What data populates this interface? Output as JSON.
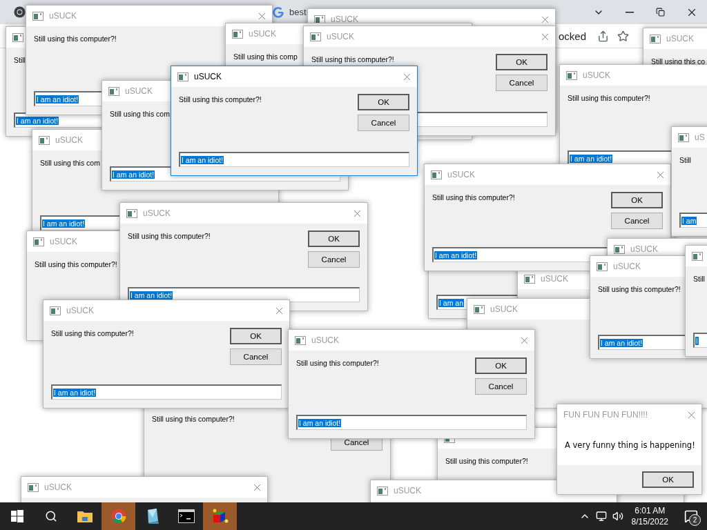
{
  "browser": {
    "tab_title": "best",
    "address_text": "ocked"
  },
  "windows": [
    {
      "kind": "dialog",
      "message": "Still",
      "field": {
        "value": "I am an idiot!",
        "selected": true
      }
    },
    {
      "kind": "dialog",
      "title": "uSUCK",
      "active": false,
      "close": true,
      "message": "Still using this computer?!",
      "field": {
        "value": "I am an idiot!",
        "selected": true
      }
    },
    {
      "kind": "dialog",
      "title": "uSUCK",
      "active": false,
      "close": true
    },
    {
      "kind": "dialog",
      "title": "uSUCK",
      "active": false,
      "message": "Still using this comp"
    },
    {
      "kind": "dialog",
      "title": "uSUCK",
      "active": false,
      "close": true,
      "message": "Still using this computer?!",
      "buttons": [
        {
          "kind": "ok",
          "label": "OK"
        },
        {
          "kind": "cancel",
          "label": "Cancel"
        }
      ],
      "field": {
        "selected": false
      }
    },
    {
      "kind": "dialog",
      "title": "uSUCK",
      "active": false,
      "message": "Still using this co"
    },
    {
      "kind": "dialog",
      "title": "uSUCK",
      "active": false,
      "message": "Still using this com",
      "field": {
        "value": "I am an idiot!",
        "selected": true
      }
    },
    {
      "kind": "dialog",
      "title": "uSUCK",
      "active": false,
      "message": "Still using this com",
      "field": {
        "value": "I am an idiot!",
        "selected": true
      }
    },
    {
      "kind": "dialog",
      "title": "uSUCK",
      "active": true,
      "close": true,
      "message": "Still using this computer?!",
      "buttons": [
        {
          "kind": "ok",
          "label": "OK"
        },
        {
          "kind": "cancel",
          "label": "Cancel"
        }
      ],
      "field": {
        "value": "I am an idiot!",
        "selected": true
      }
    },
    {
      "kind": "dialog",
      "title": "uSUCK",
      "active": false,
      "message": "Still using this computer?!",
      "field": {
        "value": "I am an idiot!",
        "selected": true
      }
    },
    {
      "kind": "dialog",
      "title": "uSUCK",
      "active": false,
      "message": "Still using this computer?!"
    },
    {
      "kind": "dialog",
      "field": {
        "value": "I am an",
        "selected": true
      }
    },
    {
      "kind": "dialog",
      "title": "uSUCK",
      "active": false
    },
    {
      "kind": "dialog",
      "title": "uSUCK",
      "active": false
    },
    {
      "kind": "dialog",
      "title": "uSUCK",
      "active": false,
      "close": true,
      "message": "Still using this computer?!",
      "buttons": [
        {
          "kind": "ok",
          "label": "OK"
        },
        {
          "kind": "cancel",
          "label": "Cancel"
        }
      ],
      "field": {
        "value": "I am an idiot!",
        "selected": true
      }
    },
    {
      "kind": "dialog",
      "title": "uS",
      "active": false,
      "message": "Still",
      "field": {
        "value": "I am",
        "selected": true
      }
    },
    {
      "kind": "dialog",
      "title": "uSUCK",
      "active": false
    },
    {
      "kind": "dialog",
      "title": "uSUCK",
      "active": false,
      "message": "Still using this computer?!",
      "field": {
        "value": "I am an idiot!",
        "selected": true
      }
    },
    {
      "kind": "dialog",
      "message": "Still",
      "field": {
        "value": "I",
        "selected": true
      }
    },
    {
      "kind": "dialog",
      "title": "uSUCK",
      "active": false,
      "close": true,
      "message": "Still using this computer?!",
      "buttons": [
        {
          "kind": "ok",
          "label": "OK"
        },
        {
          "kind": "cancel",
          "label": "Cancel"
        }
      ],
      "field": {
        "value": "I am an idiot!",
        "selected": true
      }
    },
    {
      "kind": "dialog",
      "message": "Still using this computer?!",
      "buttons": [
        {
          "kind": "cancel",
          "label": "Cancel"
        }
      ]
    },
    {
      "kind": "dialog",
      "message": "Still using this computer?!"
    },
    {
      "kind": "dialog",
      "title": "uSUCK",
      "active": false,
      "close": true,
      "message": "Still using this computer?!",
      "buttons": [
        {
          "kind": "ok",
          "label": "OK"
        },
        {
          "kind": "cancel",
          "label": "Cancel"
        }
      ],
      "field": {
        "value": "I am an idiot!",
        "selected": true
      }
    },
    {
      "kind": "dialog",
      "title": "uSUCK",
      "active": false,
      "close": true,
      "message": "Still using this computer?!",
      "buttons": [
        {
          "kind": "ok",
          "label": "OK"
        },
        {
          "kind": "cancel",
          "label": "Cancel"
        }
      ],
      "field": {
        "value": "I am an idiot!",
        "selected": true
      }
    },
    {
      "kind": "dialog",
      "title": "uSUCK",
      "active": false,
      "close": true
    },
    {
      "kind": "dialog",
      "title": "uSUCK",
      "active": false
    },
    {
      "kind": "message_box",
      "title": "FUN FUN FUN FUN!!!!",
      "active": false,
      "close": true,
      "message": "A very funny thing is happening!",
      "buttons": [
        {
          "kind": "ok",
          "label": "OK"
        }
      ]
    }
  ],
  "taskbar": {
    "apps": [
      {
        "kind": "explorer",
        "active": false
      },
      {
        "kind": "chrome",
        "active": true
      },
      {
        "kind": "notes",
        "active": false
      },
      {
        "kind": "terminal",
        "active": false
      },
      {
        "kind": "cube",
        "active": true
      }
    ],
    "clock": {
      "time": "6:01 AM",
      "date": "8/15/2022"
    },
    "notifications": {
      "count": "2"
    }
  }
}
